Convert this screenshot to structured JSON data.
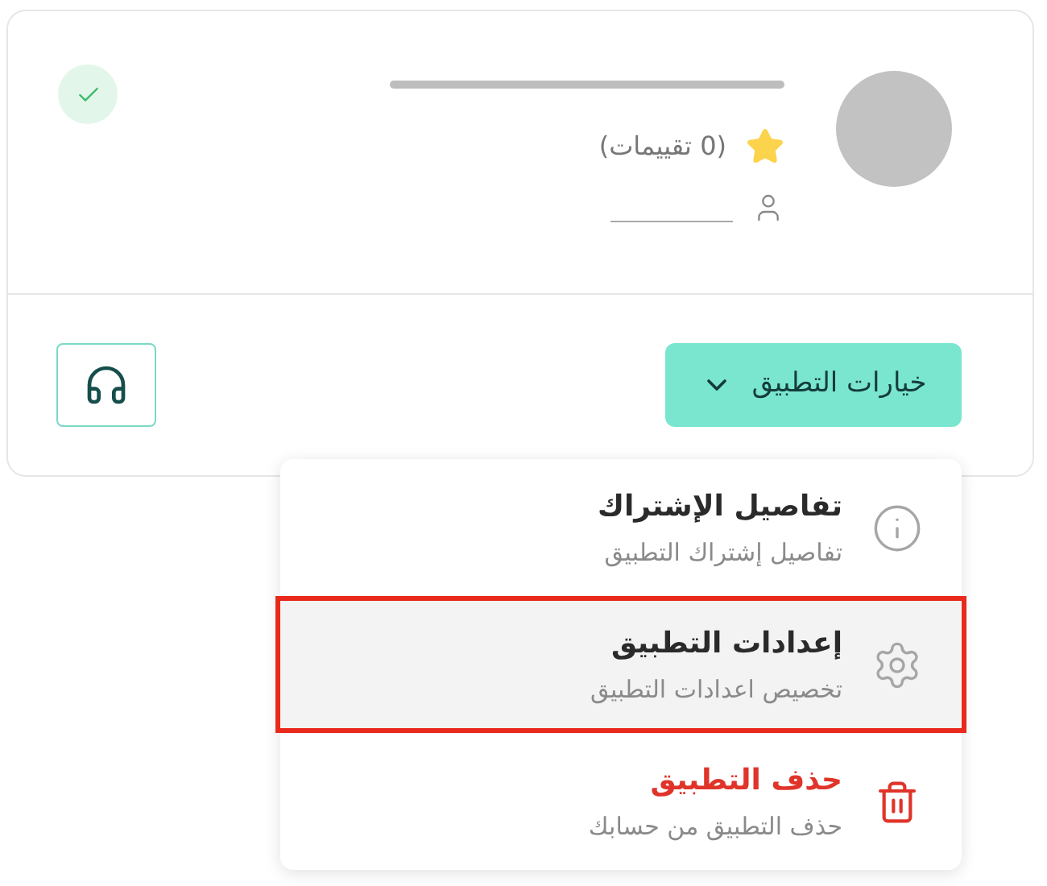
{
  "card": {
    "verified": true,
    "rating": {
      "count_label": "(0 تقييمات)"
    },
    "options_button": {
      "label": "خيارات التطبيق",
      "expanded": true
    }
  },
  "menu": {
    "items": [
      {
        "kind": "info",
        "title": "تفاصيل الإشتراك",
        "subtitle": "تفاصيل إشتراك التطبيق",
        "selected": false
      },
      {
        "kind": "settings",
        "title": "إعدادات التطبيق",
        "subtitle": "تخصيص اعدادات التطبيق",
        "selected": true
      },
      {
        "kind": "delete",
        "title": "حذف التطبيق",
        "subtitle": "حذف التطبيق من حسابك",
        "selected": false
      }
    ]
  }
}
